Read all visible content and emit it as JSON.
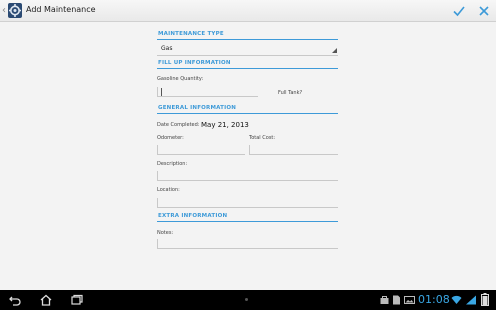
{
  "app": {
    "title": "Add Maintenance"
  },
  "actions": {
    "confirm_icon": "check-icon",
    "cancel_icon": "close-icon"
  },
  "sections": {
    "maintenance_type": "MAINTENANCE TYPE",
    "fill_up": "FILL UP INFORMATION",
    "general": "GENERAL INFORMATION",
    "extra": "EXTRA INFORMATION"
  },
  "maintenance_type": {
    "value": "Gas"
  },
  "fill_up": {
    "gasoline_label": "Gasoline Quantity:",
    "gasoline_value": "",
    "full_tank_label": "Full Tank?"
  },
  "general": {
    "date_label": "Date Completed:",
    "date_value": "May 21, 2013",
    "odometer_label": "Odometer:",
    "odometer_value": "",
    "cost_label": "Total Cost:",
    "cost_value": "",
    "description_label": "Description:",
    "location_label": "Location:"
  },
  "extra": {
    "notes_label": "Notes:"
  },
  "statusbar": {
    "time": "01:08"
  },
  "colors": {
    "accent": "#3d9ad8",
    "clock": "#3aa7e4",
    "nav_bg": "#000000"
  }
}
